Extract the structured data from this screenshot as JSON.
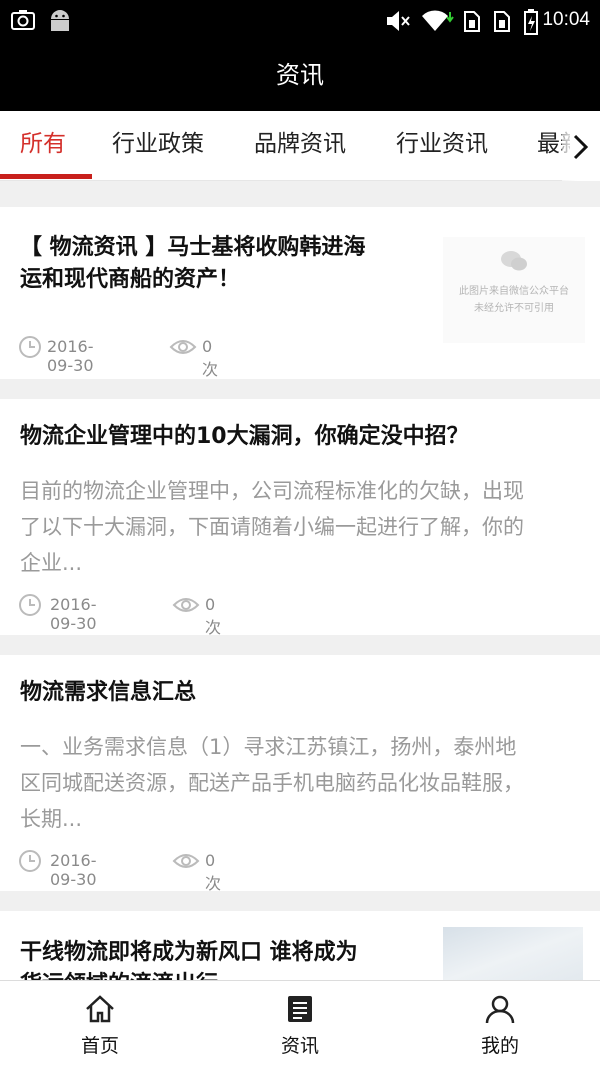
{
  "status_bar": {
    "time": "10:04",
    "icons": [
      "screenshot-icon",
      "android-icon",
      "mute-icon",
      "wifi-icon",
      "sim1-icon",
      "sim2-icon",
      "battery-icon"
    ]
  },
  "header": {
    "title": "资讯"
  },
  "tabs": {
    "items": [
      {
        "label": "所有",
        "active": true
      },
      {
        "label": "行业政策",
        "active": false
      },
      {
        "label": "品牌资讯",
        "active": false
      },
      {
        "label": "行业资讯",
        "active": false
      },
      {
        "label": "最新",
        "active": false
      }
    ],
    "accent_color": "#d4302b"
  },
  "articles": [
    {
      "title_line1": "【 物流资讯 】马士基将收购韩进海",
      "title_line2": "运和现代商船的资产！",
      "date": "2016-09-30",
      "views": "0次",
      "thumbnail_caption1": "此图片来自微信公众平台",
      "thumbnail_caption2": "未经允许不可引用"
    },
    {
      "title": "物流企业管理中的10大漏洞，你确定没中招？",
      "summary_line1": "目前的物流企业管理中，公司流程标准化的欠缺，出现",
      "summary_line2": "了以下十大漏洞，下面请随着小编一起进行了解，你的",
      "summary_line3": "企业...",
      "date": "2016-09-30",
      "views": "0次"
    },
    {
      "title": "物流需求信息汇总",
      "summary_line1": "一、业务需求信息（1）寻求江苏镇江，扬州，泰州地",
      "summary_line2": "区同城配送资源，配送产品手机电脑药品化妆品鞋服，",
      "summary_line3": "长期...",
      "date": "2016-09-30",
      "views": "0次"
    },
    {
      "title_line1": "干线物流即将成为新风口 谁将成为",
      "title_line2": "货运领域的滴滴出行"
    }
  ],
  "bottom_nav": {
    "items": [
      {
        "label": "首页",
        "icon": "home-icon"
      },
      {
        "label": "资讯",
        "icon": "news-icon"
      },
      {
        "label": "我的",
        "icon": "user-icon"
      }
    ]
  }
}
